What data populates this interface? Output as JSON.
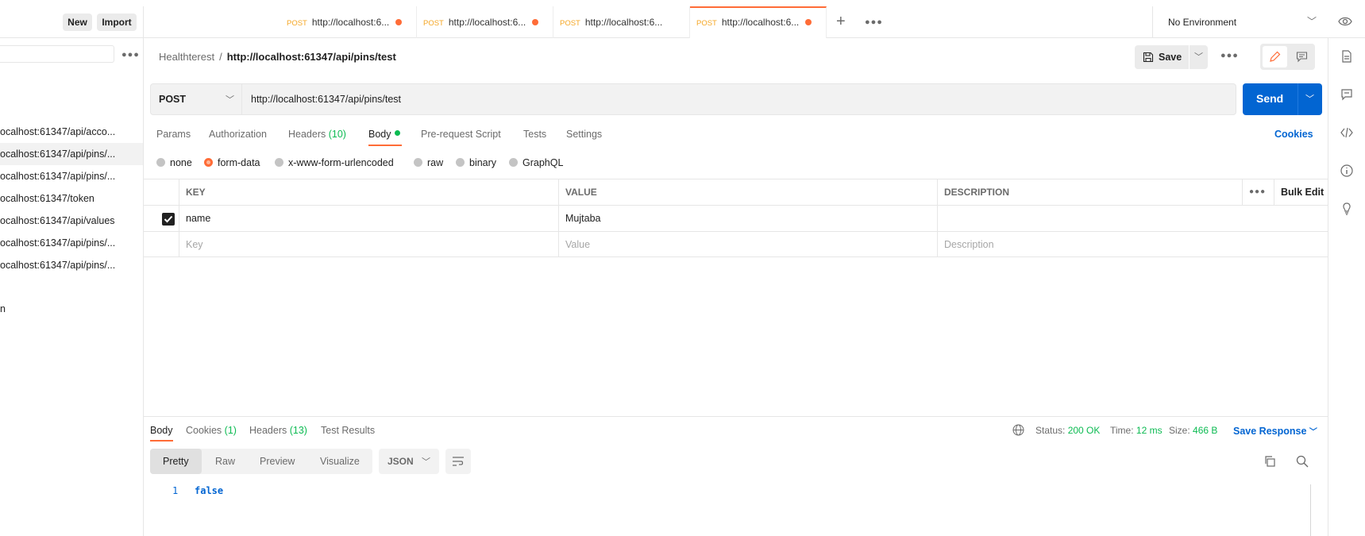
{
  "sidebar": {
    "new_label": "New",
    "import_label": "Import",
    "items": [
      {
        "label": "ocalhost:61347/api/acco..."
      },
      {
        "label": "ocalhost:61347/api/pins/..."
      },
      {
        "label": "ocalhost:61347/api/pins/..."
      },
      {
        "label": "ocalhost:61347/token"
      },
      {
        "label": "ocalhost:61347/api/values"
      },
      {
        "label": "ocalhost:61347/api/pins/..."
      },
      {
        "label": "ocalhost:61347/api/pins/..."
      }
    ],
    "fragment": "n"
  },
  "tabs": [
    {
      "method": "POST",
      "url": "http://localhost:6..."
    },
    {
      "method": "POST",
      "url": "http://localhost:6..."
    },
    {
      "method": "POST",
      "url": "http://localhost:6..."
    },
    {
      "method": "POST",
      "url": "http://localhost:6..."
    }
  ],
  "environment": {
    "label": "No Environment"
  },
  "request": {
    "collection": "Healthterest",
    "name": "http://localhost:61347/api/pins/test",
    "save_label": "Save",
    "method": "POST",
    "url": "http://localhost:61347/api/pins/test",
    "send_label": "Send",
    "tabs": {
      "params": "Params",
      "authorization": "Authorization",
      "headers": "Headers",
      "headers_count": "(10)",
      "body": "Body",
      "pre_request": "Pre-request Script",
      "tests": "Tests",
      "settings": "Settings"
    },
    "cookies_label": "Cookies",
    "body_types": [
      "none",
      "form-data",
      "x-www-form-urlencoded",
      "raw",
      "binary",
      "GraphQL"
    ],
    "body_type_selected": "form-data",
    "table": {
      "headers": {
        "key": "KEY",
        "value": "VALUE",
        "description": "DESCRIPTION",
        "bulk_edit": "Bulk Edit"
      },
      "rows": [
        {
          "key": "name",
          "value": "Mujtaba",
          "description": ""
        }
      ],
      "placeholders": {
        "key": "Key",
        "value": "Value",
        "description": "Description"
      }
    }
  },
  "response": {
    "tabs": {
      "body": "Body",
      "cookies": "Cookies",
      "cookies_count": "(1)",
      "headers": "Headers",
      "headers_count": "(13)",
      "test_results": "Test Results"
    },
    "status_label": "Status:",
    "status_value": "200 OK",
    "time_label": "Time:",
    "time_value": "12 ms",
    "size_label": "Size:",
    "size_value": "466 B",
    "save_response_label": "Save Response",
    "formats": [
      "Pretty",
      "Raw",
      "Preview",
      "Visualize"
    ],
    "language": "JSON",
    "line_number": "1",
    "body_value": "false"
  },
  "colors": {
    "accent": "#ff6c37",
    "primary": "#0265d2",
    "success": "#0cbb52",
    "method_post": "#f5a623"
  }
}
